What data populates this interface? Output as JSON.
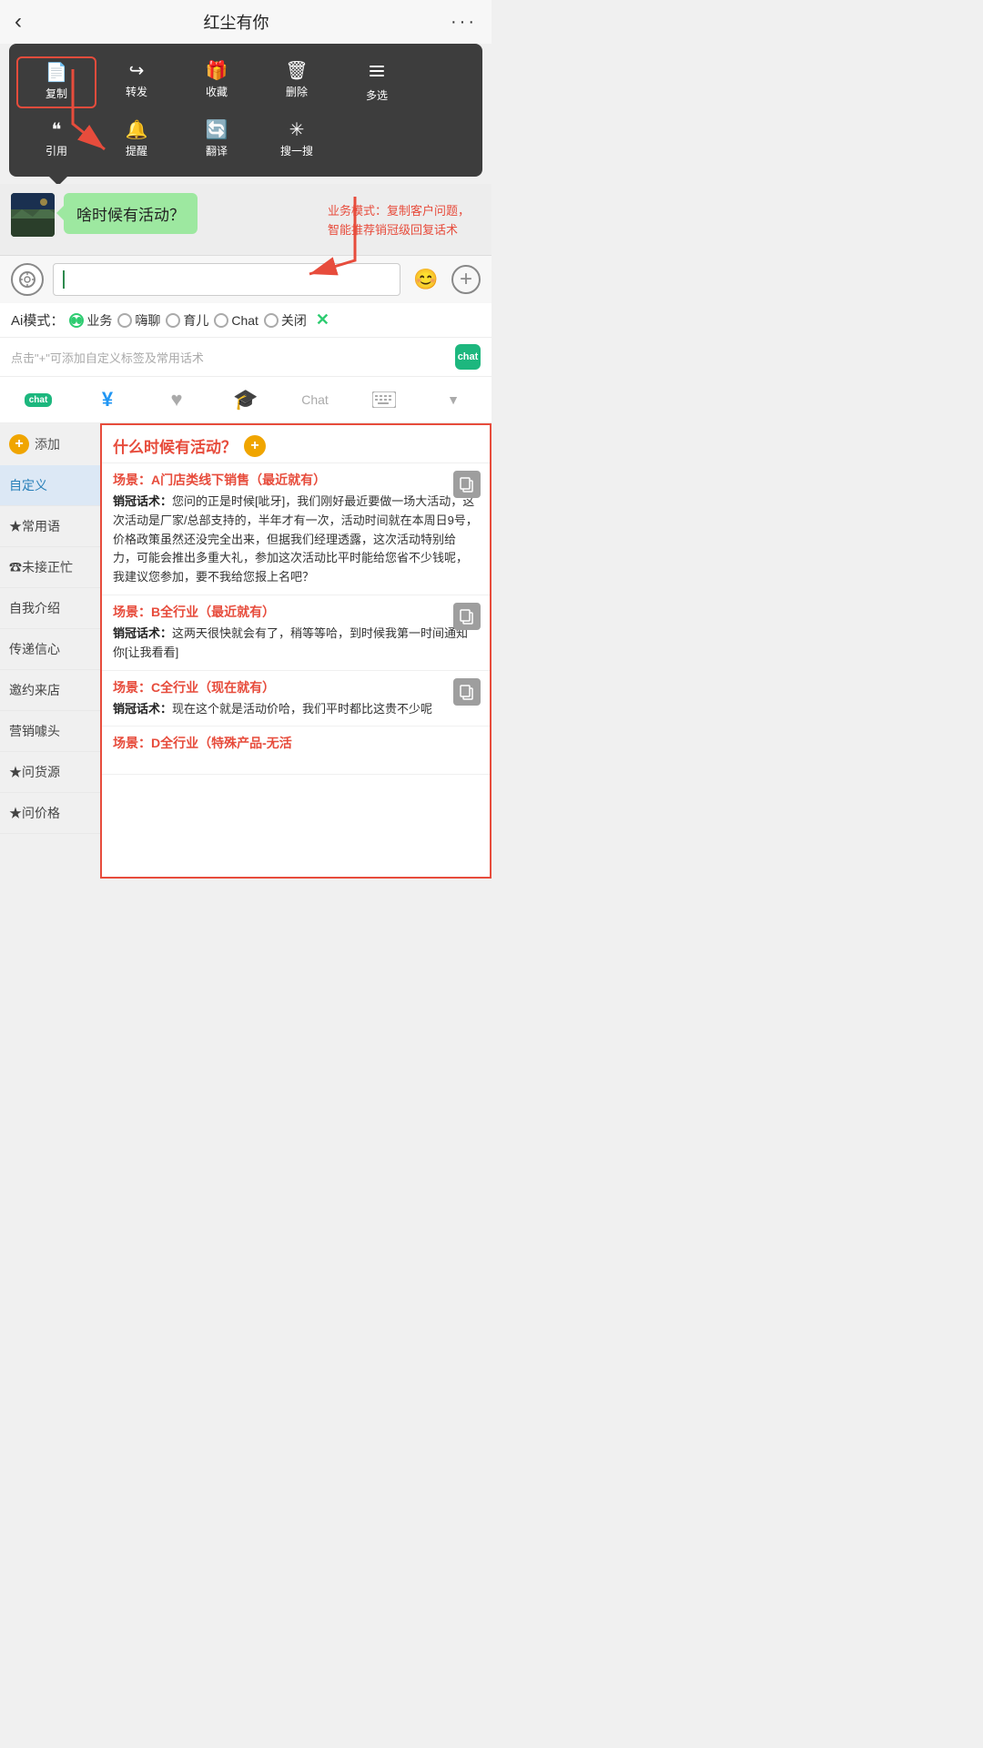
{
  "nav": {
    "back": "‹",
    "title": "红尘有你",
    "more": "···"
  },
  "context_menu": {
    "row1": [
      {
        "icon": "📄",
        "label": "复制",
        "highlighted": true
      },
      {
        "icon": "↪",
        "label": "转发",
        "highlighted": false
      },
      {
        "icon": "🎁",
        "label": "收藏",
        "highlighted": false
      },
      {
        "icon": "🗑",
        "label": "删除",
        "highlighted": false
      },
      {
        "icon": "☰",
        "label": "多选",
        "highlighted": false
      }
    ],
    "row2": [
      {
        "icon": "❝",
        "label": "引用",
        "highlighted": false
      },
      {
        "icon": "🔔",
        "label": "提醒",
        "highlighted": false
      },
      {
        "icon": "🔄",
        "label": "翻译",
        "highlighted": false
      },
      {
        "icon": "✳",
        "label": "搜一搜",
        "highlighted": false
      }
    ]
  },
  "chat": {
    "bubble_text": "啥时候有活动？",
    "annotation": "业务模式：复制客户问题，\n智能推荐销冠级回复话术"
  },
  "input_bar": {
    "placeholder": "",
    "voice_icon": "⊙",
    "emoji_icon": "😊",
    "plus_icon": "＋"
  },
  "ai_modes": {
    "label": "Ai模式：",
    "options": [
      {
        "id": "business",
        "label": "业务",
        "active": true
      },
      {
        "id": "chat",
        "label": "嗨聊",
        "active": false
      },
      {
        "id": "parenting",
        "label": "育儿",
        "active": false
      },
      {
        "id": "chat_en",
        "label": "Chat",
        "active": false
      },
      {
        "id": "off",
        "label": "关闭",
        "active": false
      }
    ],
    "close_label": "✕"
  },
  "hint_bar": {
    "text": "点击\"+\"可添加自定义标签及常用话术",
    "badge": "chat"
  },
  "tool_tabs": [
    {
      "id": "robot",
      "icon": "🤖",
      "label": "chat",
      "active": true,
      "is_badge": true
    },
    {
      "id": "money",
      "icon": "¥",
      "active": false
    },
    {
      "id": "heart",
      "icon": "♥",
      "active": false
    },
    {
      "id": "hat",
      "icon": "🎓",
      "active": false
    },
    {
      "id": "chat_tab",
      "label": "Chat",
      "active": false
    },
    {
      "id": "keyboard",
      "icon": "⌨",
      "active": false
    },
    {
      "id": "dropdown",
      "icon": "▼",
      "active": false
    }
  ],
  "sidebar": {
    "add_label": "添加",
    "items": [
      {
        "label": "自定义",
        "active": true
      },
      {
        "label": "★常用语",
        "active": false
      },
      {
        "label": "☎未接正忙",
        "active": false
      },
      {
        "label": "自我介绍",
        "active": false
      },
      {
        "label": "传递信心",
        "active": false
      },
      {
        "label": "邀约来店",
        "active": false
      },
      {
        "label": "营销噱头",
        "active": false
      },
      {
        "label": "★问货源",
        "active": false
      },
      {
        "label": "★问价格",
        "active": false
      }
    ]
  },
  "panel": {
    "title": "什么时候有活动？",
    "scenarios": [
      {
        "id": "A",
        "label": "场景：A门店类线下销售（最近就有）",
        "content_label": "销冠话术：",
        "content": "您问的正是时候[呲牙]，我们刚好最近要做一场大活动，这次活动是厂家/总部支持的，半年才有一次，活动时间就在本周日9号，价格政策虽然还没完全出来，但据我们经理透露，这次活动特别给力，可能会推出多重大礼，参加这次活动比平时能给您省不少钱呢，我建议您参加，要不我给您报上名吧？"
      },
      {
        "id": "B",
        "label": "场景：B全行业（最近就有）",
        "content_label": "销冠话术：",
        "content": "这两天很快就会有了，稍等等哈，到时候我第一时间通知你[让我看看]"
      },
      {
        "id": "C",
        "label": "场景：C全行业（现在就有）",
        "content_label": "销冠话术：",
        "content": "现在这个就是活动价哈，我们平时都比这贵不少呢"
      },
      {
        "id": "D",
        "label": "场景：D全行业（特殊产品-无活",
        "content_label": "",
        "content": ""
      }
    ]
  }
}
